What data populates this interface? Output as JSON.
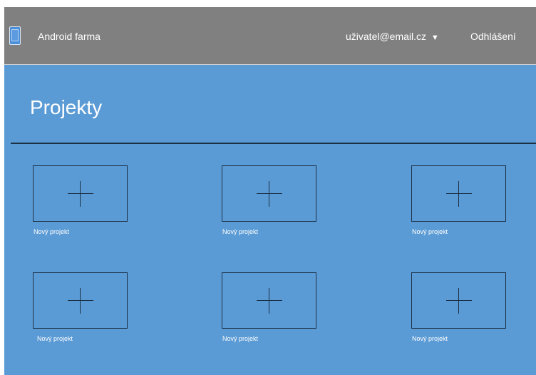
{
  "header": {
    "app_icon": "tablet-icon",
    "app_title": "Android farma",
    "user_email": "uživatel@email.cz",
    "user_caret": "▼",
    "logout_label": "Odhlášení"
  },
  "main": {
    "title": "Projekty",
    "projects": [
      {
        "label": "Nový projekt",
        "icon": "plus-icon"
      },
      {
        "label": "Nový projekt",
        "icon": "plus-icon"
      },
      {
        "label": "Nový projekt",
        "icon": "plus-icon"
      },
      {
        "label": "Nový projekt",
        "icon": "plus-icon"
      },
      {
        "label": "Nový projekt",
        "icon": "plus-icon"
      },
      {
        "label": "Nový projekt",
        "icon": "plus-icon"
      }
    ]
  },
  "colors": {
    "header_bg": "#808080",
    "main_bg": "#5b9bd5",
    "line": "#1b2f45",
    "text": "#ffffff"
  }
}
